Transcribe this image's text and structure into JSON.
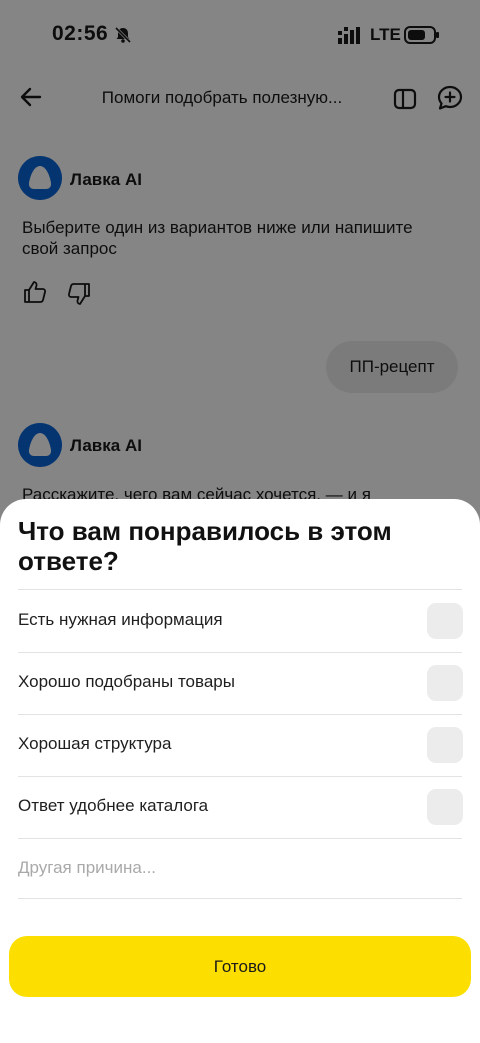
{
  "status_bar": {
    "time": "02:56",
    "network": "LTE"
  },
  "header": {
    "title": "Помоги подобрать полезную..."
  },
  "chat": {
    "bot_name": "Лавка AI",
    "message_1": "Выберите один из вариантов ниже или напишите свой запрос",
    "user_message": "ПП-рецепт",
    "message_2": "Расскажите, чего вам сейчас хочется, — и я"
  },
  "feedback_sheet": {
    "title": "Что вам понравилось в этом ответе?",
    "options": [
      {
        "label": "Есть нужная информация",
        "checked": false
      },
      {
        "label": "Хорошо подобраны товары",
        "checked": false
      },
      {
        "label": "Хорошая структура",
        "checked": false
      },
      {
        "label": "Ответ удобнее каталога",
        "checked": false
      }
    ],
    "other_reason_placeholder": "Другая причина...",
    "other_reason_value": "",
    "done_label": "Готово"
  },
  "colors": {
    "accent_yellow": "#fcdf00",
    "avatar_blue": "#0a66d8",
    "overlay": "rgba(0,0,0,0.48)"
  }
}
